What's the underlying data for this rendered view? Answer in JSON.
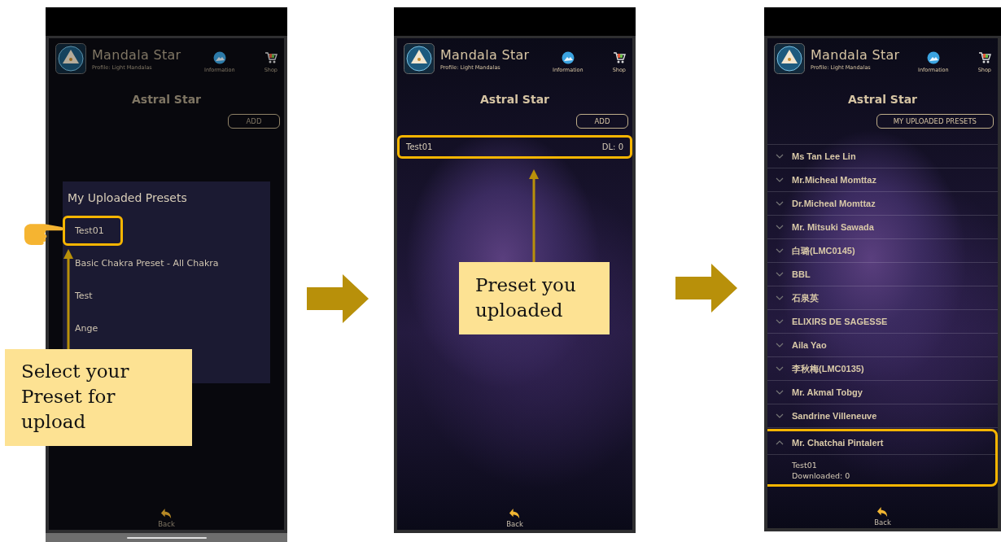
{
  "phones": [
    {
      "app_title": "Mandala Star",
      "profile": "Profile: Light Mandalas",
      "info_label": "Information",
      "shop_label": "Shop",
      "screen_title": "Astral Star",
      "action_button": "ADD",
      "dimmed": true,
      "nav_bar": true,
      "back_label": "Back",
      "content": {
        "kind": "dialog",
        "title": "My Uploaded Presets",
        "items": [
          {
            "label": "Test01",
            "highlighted": true
          },
          {
            "label": "Basic Chakra Preset - All Chakra",
            "highlighted": false
          },
          {
            "label": "Test",
            "highlighted": false
          },
          {
            "label": "Ange",
            "highlighted": false
          }
        ]
      }
    },
    {
      "app_title": "Mandala Star",
      "profile": "Profile: Light Mandalas",
      "info_label": "Information",
      "shop_label": "Shop",
      "screen_title": "Astral Star",
      "action_button": "ADD",
      "dimmed": false,
      "back_label": "Back",
      "content": {
        "kind": "preset_list",
        "rows": [
          {
            "name": "Test01",
            "downloads": "DL: 0",
            "highlighted": true
          }
        ]
      }
    },
    {
      "app_title": "Mandala Star",
      "profile": "Profile: Light Mandalas",
      "info_label": "Information",
      "shop_label": "Shop",
      "screen_title": "Astral Star",
      "action_button": "MY UPLOADED PRESETS",
      "dimmed": false,
      "back_label": "Back",
      "content": {
        "kind": "accordion",
        "groups": [
          {
            "name": "Ms Tan Lee Lin",
            "expanded": false,
            "highlighted": false
          },
          {
            "name": "Mr.Micheal Momttaz",
            "expanded": false,
            "highlighted": false
          },
          {
            "name": "Dr.Micheal Momttaz",
            "expanded": false,
            "highlighted": false
          },
          {
            "name": "Mr. Mitsuki Sawada",
            "expanded": false,
            "highlighted": false
          },
          {
            "name": "白璐(LMC0145)",
            "expanded": false,
            "highlighted": false
          },
          {
            "name": "BBL",
            "expanded": false,
            "highlighted": false
          },
          {
            "name": "石泉英",
            "expanded": false,
            "highlighted": false
          },
          {
            "name": "ELIXIRS DE SAGESSE",
            "expanded": false,
            "highlighted": false
          },
          {
            "name": "Aila Yao",
            "expanded": false,
            "highlighted": false
          },
          {
            "name": "李秋梅(LMC0135)",
            "expanded": false,
            "highlighted": false
          },
          {
            "name": "Mr. Akmal Tobgy",
            "expanded": false,
            "highlighted": false
          },
          {
            "name": "Sandrine Villeneuve",
            "expanded": false,
            "highlighted": false
          },
          {
            "name": "Mr. Chatchai Pintalert",
            "expanded": true,
            "highlighted": true,
            "presets": [
              {
                "name": "Test01",
                "downloads": "Downloaded: 0"
              }
            ]
          }
        ]
      }
    }
  ],
  "callouts": [
    {
      "text": "Select your Preset for upload"
    },
    {
      "text": "Preset you uploaded"
    }
  ]
}
